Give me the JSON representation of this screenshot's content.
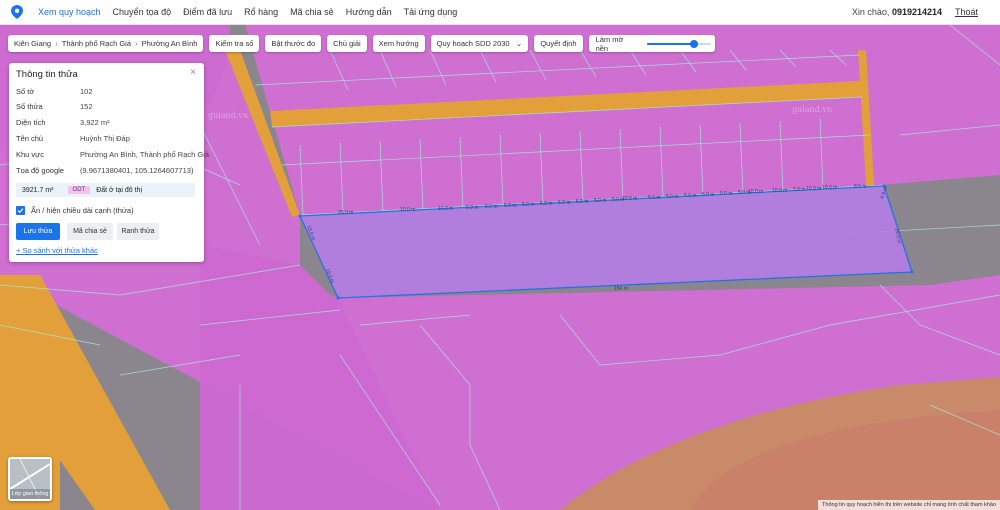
{
  "nav": {
    "items": [
      "Xem quy hoạch",
      "Chuyển tọa độ",
      "Điểm đã lưu",
      "Rổ hàng",
      "Mã chia sẻ",
      "Hướng dẫn",
      "Tải ứng dụng"
    ],
    "active_index": 0,
    "greeting_prefix": "Xin chào,",
    "phone": "0919214214",
    "logout": "Thoát"
  },
  "toolbar": {
    "breadcrumb": [
      "Kiên Giang",
      "Thành phố Rạch Giá",
      "Phường An Bình"
    ],
    "check_label": "Kiểm tra số",
    "measure_label": "Bật thước đo",
    "legend_label": "Chú giải",
    "direction_label": "Xem hướng",
    "plan_select": "Quy hoạch SDD 2030",
    "decision_label": "Quyết định",
    "opacity_label": "Làm mờ nền",
    "opacity_value": 0.72
  },
  "panel": {
    "title": "Thông tin thửa",
    "close": "×",
    "rows": [
      {
        "key": "Số tờ",
        "value": "102"
      },
      {
        "key": "Số thửa",
        "value": "152"
      },
      {
        "key": "Diện tích",
        "value": "3,922 m²"
      },
      {
        "key": "Tên chủ",
        "value": "Huỳnh Thị Đáp"
      },
      {
        "key": "Khu vực",
        "value": "Phường An Bình, Thành phố Rạch Giá"
      },
      {
        "key": "Tọa độ google",
        "value": "(9.9671380401, 105.1264607713)"
      }
    ],
    "area_value": "3921.7 m²",
    "land_code": "ODT",
    "land_desc": "Đất ở tại đô thị",
    "checkbox_label": "Ẩn / hiện chiều dài cạnh (thửa)",
    "checkbox_checked": true,
    "save_button": "Lưu thửa",
    "share_button": "Mã chia sẻ",
    "clear_button": "Ranh thửa",
    "compare_link": "+ So sánh với thửa khác"
  },
  "map": {
    "watermarks": [
      "guland.vn",
      "guland.vn"
    ],
    "edge_labels": {
      "top": [
        "25.0 m",
        "10.0 m",
        "10.0 m",
        "5.0 m",
        "5.0 m",
        "5.0 m",
        "5.0 m",
        "5.0 m",
        "5.0 m",
        "5.0 m",
        "5.0 m",
        "5.0 m",
        "10.0 m",
        "5.0 m",
        "5.0 m",
        "5.0 m",
        "5.0 m",
        "5.0 m",
        "5.0 m",
        "10.0 m",
        "10.0 m",
        "5.0 m",
        "10.0 m",
        "10.0 m",
        "8.5 m"
      ],
      "bottom": "156 m",
      "left": [
        "15.0 m",
        "15.0 m"
      ],
      "right": [
        "4.9 m",
        "25.0 m"
      ]
    },
    "layer_toggle_label": "Lớp giao thông",
    "disclaimer": "Thông tin quy hoạch hiển thị trên website chỉ mang tính chất tham khảo",
    "colors": {
      "residential": "#d66ed8",
      "orange_zone": "#e3a03a",
      "parcel_fill": "#b67ee4",
      "parcel_border": "#1a73e8",
      "boundary": "#78d8c0"
    }
  }
}
